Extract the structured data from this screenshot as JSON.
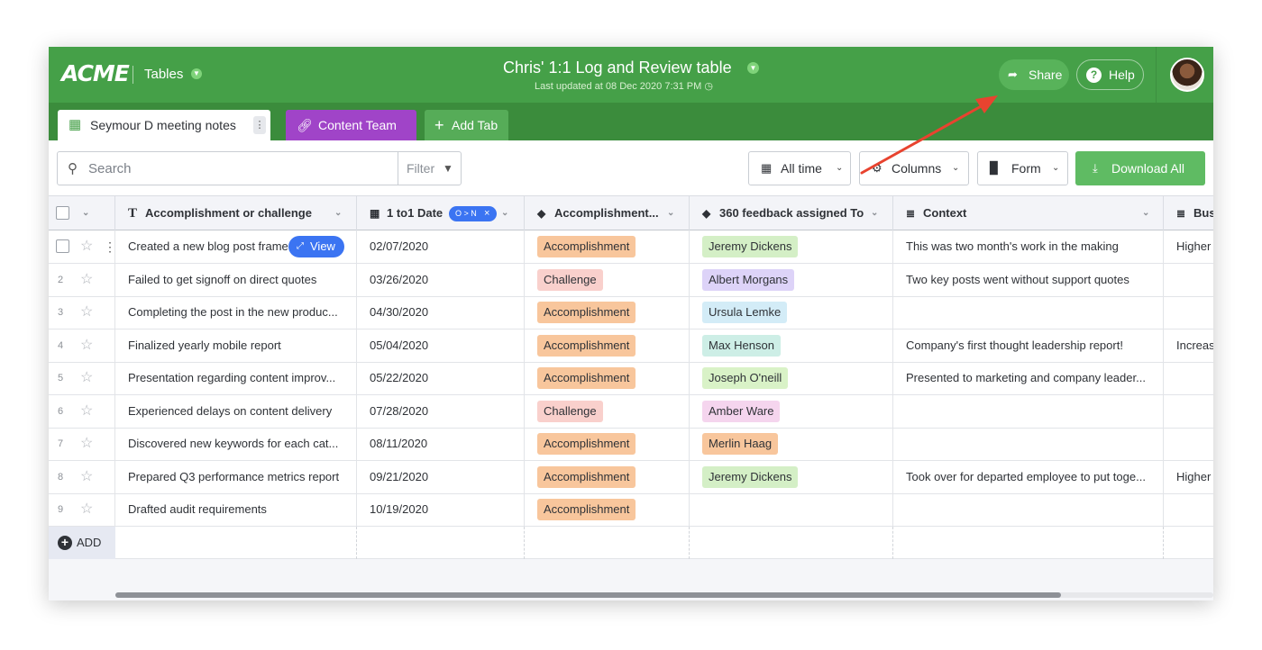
{
  "header": {
    "logo": "ACME",
    "section": "Tables",
    "title": "Chris' 1:1 Log and Review table",
    "subtitle": "Last updated at 08 Dec 2020 7:31 PM",
    "share_label": "Share",
    "help_label": "Help"
  },
  "tabs": [
    {
      "label": "Seymour D meeting notes",
      "icon": "table-icon"
    },
    {
      "label": "Content Team",
      "icon": "link-icon"
    },
    {
      "label": "Add Tab",
      "icon": "plus-icon"
    }
  ],
  "toolbar": {
    "search_placeholder": "Search",
    "filter_label": "Filter",
    "time_label": "All time",
    "columns_label": "Columns",
    "form_label": "Form",
    "download_label": "Download All"
  },
  "columns": [
    {
      "label": "Accomplishment or challenge",
      "icon": "text-type-icon"
    },
    {
      "label": "1 to1 Date",
      "icon": "calendar-icon",
      "badge": "O > N"
    },
    {
      "label": "Accomplishment...",
      "icon": "tag-icon"
    },
    {
      "label": "360 feedback assigned To",
      "icon": "tag-icon"
    },
    {
      "label": "Context",
      "icon": "long-text-icon"
    },
    {
      "label": "Bus",
      "icon": "long-text-icon"
    }
  ],
  "rows": [
    {
      "num": "1",
      "task": "Created a new blog post frame",
      "date": "02/07/2020",
      "type": "Accomplishment",
      "person": "Jeremy Dickens",
      "context": "This was two month's work in the making",
      "extra": "Higher"
    },
    {
      "num": "2",
      "task": "Failed to get signoff on direct quotes",
      "date": "03/26/2020",
      "type": "Challenge",
      "person": "Albert Morgans",
      "context": "Two key posts went without support quotes",
      "extra": ""
    },
    {
      "num": "3",
      "task": "Completing the post in the new produc...",
      "date": "04/30/2020",
      "type": "Accomplishment",
      "person": "Ursula Lemke",
      "context": "",
      "extra": ""
    },
    {
      "num": "4",
      "task": "Finalized yearly mobile report",
      "date": "05/04/2020",
      "type": "Accomplishment",
      "person": "Max Henson",
      "context": "Company's first thought leadership report!",
      "extra": "Increas"
    },
    {
      "num": "5",
      "task": "Presentation regarding content improv...",
      "date": "05/22/2020",
      "type": "Accomplishment",
      "person": "Joseph O'neill",
      "context": "Presented to marketing and company leader...",
      "extra": ""
    },
    {
      "num": "6",
      "task": "Experienced delays on content delivery",
      "date": "07/28/2020",
      "type": "Challenge",
      "person": "Amber Ware",
      "context": "",
      "extra": ""
    },
    {
      "num": "7",
      "task": "Discovered new keywords for each cat...",
      "date": "08/11/2020",
      "type": "Accomplishment",
      "person": "Merlin Haag",
      "context": "",
      "extra": ""
    },
    {
      "num": "8",
      "task": "Prepared Q3 performance metrics report",
      "date": "09/21/2020",
      "type": "Accomplishment",
      "person": "Jeremy Dickens",
      "context": "Took over for departed employee to put toge...",
      "extra": "Higher"
    },
    {
      "num": "9",
      "task": "Drafted audit requirements",
      "date": "10/19/2020",
      "type": "Accomplishment",
      "person": "",
      "context": "",
      "extra": ""
    }
  ],
  "view_label": "View",
  "add_label": "ADD",
  "colors": {
    "header_green": "#45a048",
    "tabbar_green": "#3b8c3c",
    "accomplishment": "#f8c69c",
    "challenge": "#f9d0cc",
    "person_colors": {
      "Jeremy Dickens": "#d4efc6",
      "Albert Morgans": "#ddd3f8",
      "Ursula Lemke": "#d3ecf7",
      "Max Henson": "#cdeee6",
      "Joseph O'neill": "#d9f2c7",
      "Amber Ware": "#f5d5ee",
      "Merlin Haag": "#f8c69c"
    },
    "arrow": "#e8432f"
  }
}
